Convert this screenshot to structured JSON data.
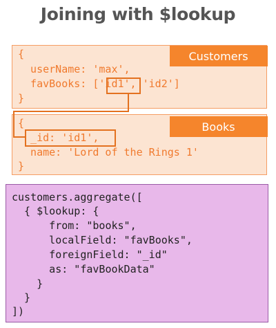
{
  "title": "Joining with $lookup",
  "customers": {
    "tag": "Customers",
    "lines": [
      "{",
      "  userName: 'max',",
      "  favBooks: ['id1', 'id2']",
      "}"
    ]
  },
  "books": {
    "tag": "Books",
    "lines": [
      "{",
      "  _id: 'id1',",
      "  name: 'Lord of the Rings 1'",
      "}"
    ]
  },
  "code": {
    "lines": [
      "customers.aggregate([",
      "  { $lookup: {",
      "      from: \"books\",",
      "      localField: \"favBooks\",",
      "      foreignField: \"_id\"",
      "      as: \"favBookData\"",
      "    }",
      "  }",
      "])"
    ]
  },
  "colors": {
    "doc_fill": "#fce4d2",
    "doc_text": "#f07a2e",
    "tag_fill": "#f5852c",
    "code_fill": "#e8b8ea",
    "code_border": "#9a5aa6"
  }
}
